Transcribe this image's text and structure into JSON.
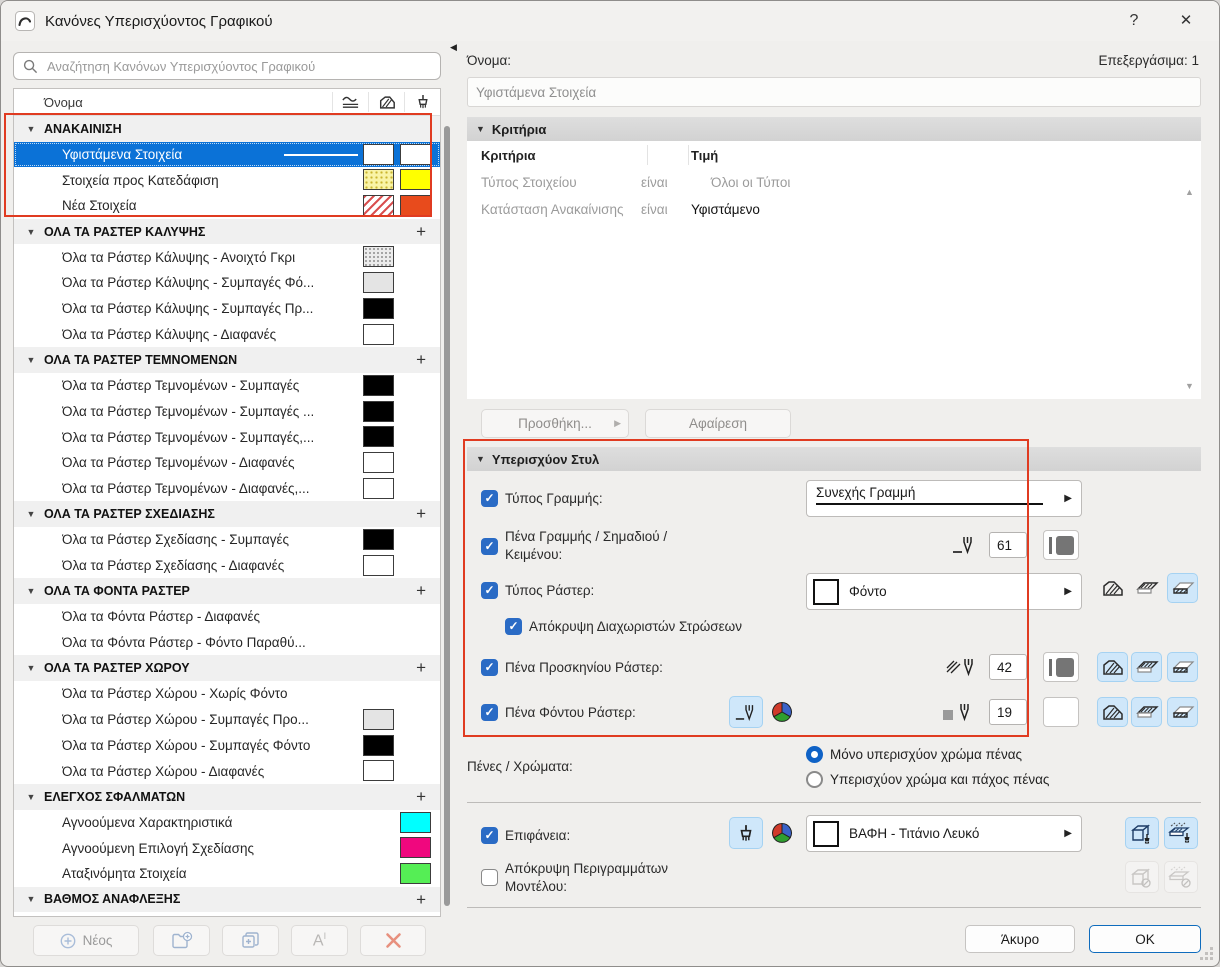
{
  "window": {
    "title": "Κανόνες Υπερισχύοντος Γραφικού",
    "help": "?",
    "close": "✕"
  },
  "colors": {
    "selection_blue": "#0b72d7",
    "accent_blue": "#2a6bc5",
    "icon_button_blue": "#cfe7fa",
    "annotation_red": "#e03b21",
    "ok_border_blue": "#0f6cbd"
  },
  "palette": {
    "white": "#ffffff",
    "black": "#000000",
    "lightgray": "#e4e4e4",
    "yellow": "#ffff00",
    "orangered": "#e84b1c",
    "cyan": "#00ffff",
    "magenta": "#f0077e",
    "green": "#55ee55"
  },
  "left": {
    "search_placeholder": "Αναζήτηση Κανόνων Υπερισχύοντος Γραφικού",
    "name_column": "Όνομα",
    "rows": [
      {
        "kind": "group",
        "label": "ΑΝΑΚΑΙΝΙΣΗ",
        "plus": false
      },
      {
        "kind": "item",
        "label": "Υφιστάμενα Στοιχεία",
        "selected": true,
        "line": true,
        "fill": "white",
        "surface": "white"
      },
      {
        "kind": "item",
        "label": "Στοιχεία προς Κατεδάφιση",
        "fill": "yellow-dots",
        "surface": "yellow"
      },
      {
        "kind": "item",
        "label": "Νέα Στοιχεία",
        "fill": "red-hatch",
        "surface": "orangered"
      },
      {
        "kind": "group",
        "label": "ΟΛΑ ΤΑ ΡΑΣΤΕΡ ΚΑΛΥΨΗΣ",
        "plus": true
      },
      {
        "kind": "item",
        "label": "Όλα τα Ράστερ Κάλυψης - Ανοιχτό Γκρι",
        "fill": "gray-dots"
      },
      {
        "kind": "item",
        "label": "Όλα τα Ράστερ Κάλυψης - Συμπαγές Φό...",
        "fill": "lightgray"
      },
      {
        "kind": "item",
        "label": "Όλα τα Ράστερ Κάλυψης - Συμπαγές Πρ...",
        "fill": "black"
      },
      {
        "kind": "item",
        "label": "Όλα τα Ράστερ Κάλυψης - Διαφανές",
        "fill": "white"
      },
      {
        "kind": "group",
        "label": "ΟΛΑ ΤΑ ΡΑΣΤΕΡ ΤΕΜΝΟΜΕΝΩΝ",
        "plus": true
      },
      {
        "kind": "item",
        "label": "Όλα τα Ράστερ Τεμνομένων - Συμπαγές",
        "fill": "black"
      },
      {
        "kind": "item",
        "label": "Όλα τα Ράστερ Τεμνομένων - Συμπαγές ...",
        "fill": "black"
      },
      {
        "kind": "item",
        "label": "Όλα τα Ράστερ Τεμνομένων - Συμπαγές,...",
        "fill": "black"
      },
      {
        "kind": "item",
        "label": "Όλα τα Ράστερ Τεμνομένων - Διαφανές",
        "fill": "white"
      },
      {
        "kind": "item",
        "label": "Όλα τα Ράστερ Τεμνομένων - Διαφανές,...",
        "fill": "white"
      },
      {
        "kind": "group",
        "label": "ΟΛΑ ΤΑ ΡΑΣΤΕΡ ΣΧΕΔΙΑΣΗΣ",
        "plus": true
      },
      {
        "kind": "item",
        "label": "Όλα τα Ράστερ Σχεδίασης - Συμπαγές",
        "fill": "black"
      },
      {
        "kind": "item",
        "label": "Όλα τα Ράστερ Σχεδίασης - Διαφανές",
        "fill": "white"
      },
      {
        "kind": "group",
        "label": "ΟΛΑ ΤΑ ΦΟΝΤΑ ΡΑΣΤΕΡ",
        "plus": true
      },
      {
        "kind": "item",
        "label": "Όλα τα Φόντα Ράστερ - Διαφανές"
      },
      {
        "kind": "item",
        "label": "Όλα τα Φόντα Ράστερ - Φόντο Παραθύ..."
      },
      {
        "kind": "group",
        "label": "ΟΛΑ ΤΑ ΡΑΣΤΕΡ ΧΩΡΟΥ",
        "plus": true
      },
      {
        "kind": "item",
        "label": "Όλα τα Ράστερ Χώρου - Χωρίς Φόντο"
      },
      {
        "kind": "item",
        "label": "Όλα τα Ράστερ Χώρου - Συμπαγές Προ...",
        "fill": "lightgray"
      },
      {
        "kind": "item",
        "label": "Όλα τα Ράστερ Χώρου - Συμπαγές Φόντο",
        "fill": "black"
      },
      {
        "kind": "item",
        "label": "Όλα τα Ράστερ Χώρου - Διαφανές",
        "fill": "white"
      },
      {
        "kind": "group",
        "label": "ΕΛΕΓΧΟΣ ΣΦΑΛΜΑΤΩΝ",
        "plus": true
      },
      {
        "kind": "item",
        "label": "Αγνοούμενα Χαρακτηριστικά",
        "surface": "cyan"
      },
      {
        "kind": "item",
        "label": "Αγνοούμενη Επιλογή Σχεδίασης",
        "surface": "magenta"
      },
      {
        "kind": "item",
        "label": "Αταξινόμητα Στοιχεία",
        "surface": "green"
      },
      {
        "kind": "group",
        "label": "ΒΑΘΜΟΣ ΑΝΑΦΛΕΞΗΣ",
        "plus": true
      }
    ],
    "new_button": "Νέος"
  },
  "right": {
    "name_label": "Όνομα:",
    "editable_label": "Επεξεργάσιμα: 1",
    "name_value": "Υφιστάμενα Στοιχεία",
    "criteria": {
      "header": "Κριτήρια",
      "col_criteria": "Κριτήρια",
      "col_value": "Τιμή",
      "rows": [
        {
          "criterion": "Τύπος Στοιχείου",
          "op": "είναι",
          "value": "Όλοι οι Τύποι"
        },
        {
          "criterion": "Κατάσταση Ανακαίνισης",
          "op": "είναι",
          "value": "Υφιστάμενο"
        }
      ],
      "add_button": "Προσθήκη...",
      "remove_button": "Αφαίρεση"
    },
    "style": {
      "header": "Υπερισχύον Στυλ",
      "line_type_label": "Τύπος Γραμμής:",
      "line_type_value": "Συνεχής Γραμμή",
      "pen_label": "Πένα Γραμμής / Σημαδιού / Κειμένου:",
      "pen_value": "61",
      "fill_type_label": "Τύπος Ράστερ:",
      "fill_type_value": "Φόντο",
      "hide_separators_label": "Απόκρυψη Διαχωριστών Στρώσεων",
      "fg_pen_label": "Πένα Προσκηνίου Ράστερ:",
      "fg_pen_value": "42",
      "bg_pen_label": "Πένα Φόντου Ράστερ:",
      "bg_pen_value": "19",
      "pens_colors_label": "Πένες / Χρώματα:",
      "radio_pen_color_only": "Μόνο υπερισχύον χρώμα πένας",
      "radio_pen_color_weight": "Υπερισχύον χρώμα και πάχος πένας",
      "surface_label": "Επιφάνεια:",
      "surface_value": "ΒΑΦΗ - Τιτάνιο Λευκό",
      "hide_outlines_label": "Απόκρυψη Περιγραμμάτων Μοντέλου:"
    },
    "footer": {
      "cancel": "Άκυρο",
      "ok": "OK"
    }
  }
}
